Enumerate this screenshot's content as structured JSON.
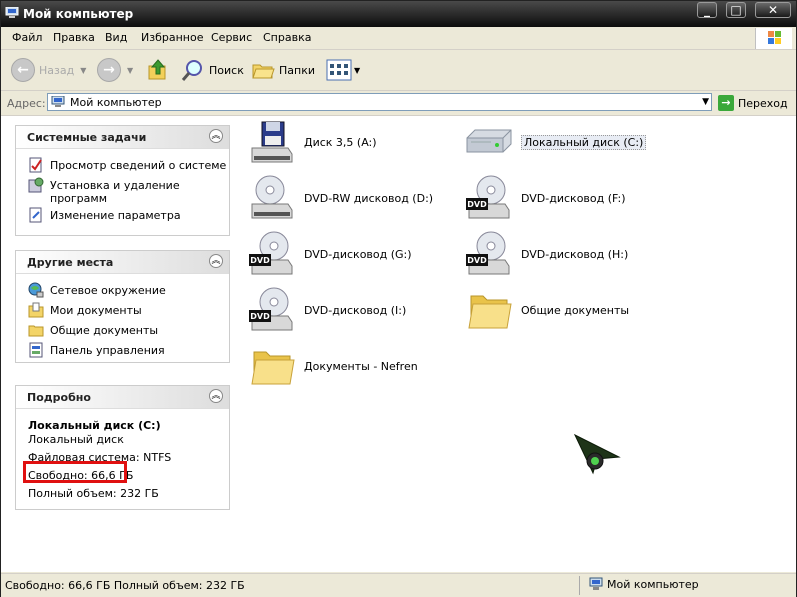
{
  "window": {
    "title": "Мой компьютер"
  },
  "titlebar_buttons": {
    "minimize": "_",
    "maximize": "□",
    "close": "✕"
  },
  "menu": [
    "Файл",
    "Правка",
    "Вид",
    "Избранное",
    "Сервис",
    "Справка"
  ],
  "toolbar": {
    "back": "Назад",
    "search": "Поиск",
    "folders": "Папки"
  },
  "address": {
    "label": "Адрес:",
    "value": "Мой компьютер",
    "go": "Переход"
  },
  "system_tasks": {
    "title": "Системные задачи",
    "items": [
      "Просмотр сведений о системе",
      "Установка и удаление программ",
      "Изменение параметра"
    ]
  },
  "other_places": {
    "title": "Другие места",
    "items": [
      "Сетевое окружение",
      "Мои документы",
      "Общие документы",
      "Панель управления"
    ]
  },
  "details": {
    "title": "Подробно",
    "name": "Локальный диск (C:)",
    "type": "Локальный диск",
    "filesystem": "Файловая система: NTFS",
    "free": "Свободно: 66,6 ГБ",
    "total": "Полный объем: 232 ГБ"
  },
  "items": [
    {
      "label": "Диск 3,5 (A:)",
      "icon": "floppy-drive-icon"
    },
    {
      "label": "Локальный диск (C:)",
      "icon": "hard-drive-icon",
      "selected": true
    },
    {
      "label": "DVD-RW дисковод (D:)",
      "icon": "cd-drive-icon"
    },
    {
      "label": "DVD-дисковод (F:)",
      "icon": "dvd-drive-icon"
    },
    {
      "label": "DVD-дисковод (G:)",
      "icon": "dvd-drive-icon"
    },
    {
      "label": "DVD-дисковод (H:)",
      "icon": "dvd-drive-icon"
    },
    {
      "label": "DVD-дисковод (I:)",
      "icon": "dvd-drive-icon"
    },
    {
      "label": "Общие документы",
      "icon": "folder-icon"
    },
    {
      "label": "Документы - Nefren",
      "icon": "folder-icon"
    }
  ],
  "dvd_badge": "DVD",
  "status": {
    "left": "Свободно: 66,6 ГБ Полный объем: 232 ГБ",
    "right": "Мой компьютер"
  },
  "colors": {
    "highlight": "#e01010",
    "titlebar": "#0c0c0c",
    "go": "#3aa83a"
  }
}
